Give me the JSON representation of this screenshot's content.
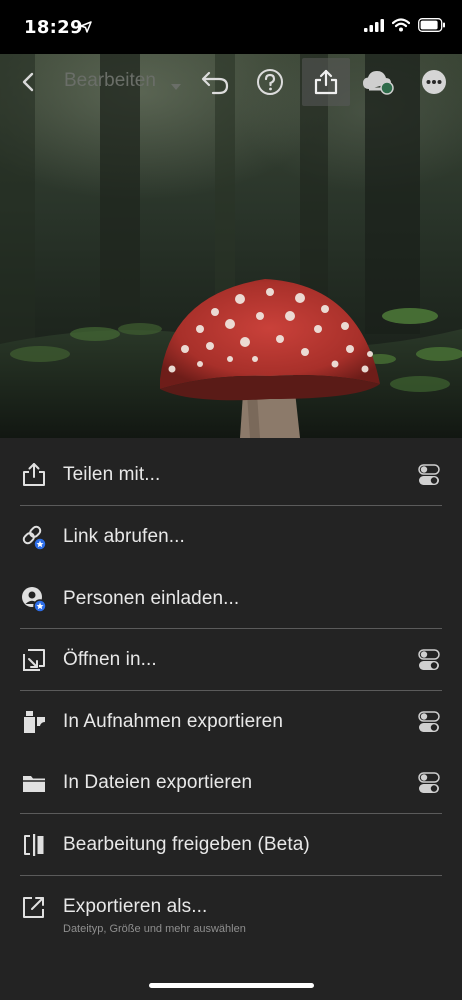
{
  "status_bar": {
    "time": "18:29",
    "icons": [
      "location-arrow-icon",
      "signal-icon",
      "wifi-icon",
      "battery-icon"
    ]
  },
  "toolbar": {
    "title": "Bearbeiten",
    "icons": [
      "back-chevron-icon",
      "dropdown-caret-icon",
      "undo-icon",
      "help-icon",
      "share-icon",
      "cloud-sync-icon",
      "more-icon"
    ]
  },
  "menu": {
    "items": [
      {
        "label": "Teilen mit...",
        "icon": "share-icon",
        "has_toggle": true
      },
      {
        "label": "Link abrufen...",
        "icon": "link-icon",
        "has_toggle": false
      },
      {
        "label": "Personen einladen...",
        "icon": "invite-person-icon",
        "has_toggle": false
      },
      {
        "label": "Öffnen in...",
        "icon": "open-in-icon",
        "has_toggle": true
      },
      {
        "label": "In Aufnahmen exportieren",
        "icon": "camera-roll-icon",
        "has_toggle": true
      },
      {
        "label": "In Dateien exportieren",
        "icon": "folder-icon",
        "has_toggle": true
      },
      {
        "label": "Bearbeitung freigeben (Beta)",
        "icon": "edit-share-icon",
        "has_toggle": false
      },
      {
        "label": "Exportieren als...",
        "sublabel": "Dateityp, Größe und mehr auswählen",
        "icon": "export-as-icon",
        "has_toggle": false
      }
    ]
  },
  "colors": {
    "sheet_bg": "#232323",
    "divider": "#5b5b5b",
    "badge_blue": "#2d6ee8"
  }
}
